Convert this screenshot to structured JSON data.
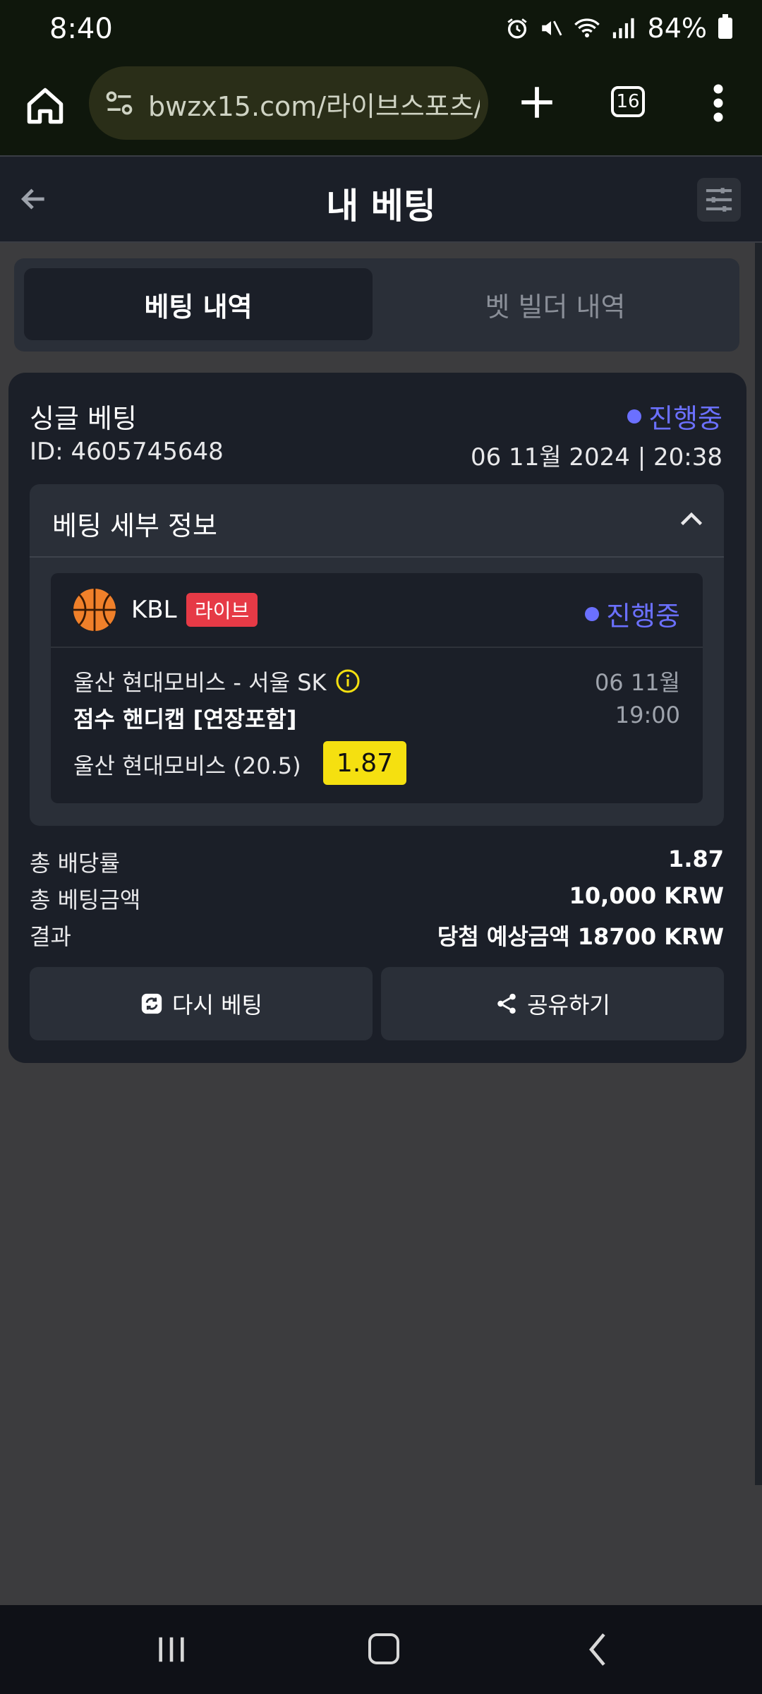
{
  "status_bar": {
    "time": "8:40",
    "battery_percent": "84%"
  },
  "browser": {
    "url": "bwzx15.com/라이브스포츠/ma",
    "tab_count": "16"
  },
  "header": {
    "title": "내 베팅"
  },
  "tabs": [
    {
      "label": "베팅 내역",
      "active": true
    },
    {
      "label": "벳 빌더 내역",
      "active": false
    }
  ],
  "bet": {
    "type": "싱글 베팅",
    "status": "진행중",
    "id": "ID: 4605745648",
    "datetime": "06 11월 2024 | 20:38",
    "details_title": "베팅 세부 정보",
    "event": {
      "league": "KBL",
      "live_label": "라이브",
      "status": "진행중",
      "match": "울산 현대모비스 - 서울 SK",
      "date": "06 11월",
      "time": "19:00",
      "market": "점수 핸디캡 [연장포함]",
      "selection": "울산 현대모비스 (20.5)",
      "odds": "1.87"
    },
    "summary": {
      "total_odds_label": "총 배당률",
      "total_odds": "1.87",
      "total_stake_label": "총 베팅금액",
      "total_stake": "10,000 KRW",
      "result_label": "결과",
      "result": "당첨 예상금액 18700 KRW"
    },
    "actions": {
      "rebet_label": "다시 베팅",
      "share_label": "공유하기"
    }
  },
  "colors": {
    "accent": "#6b70ff",
    "live_badge": "#e63a46",
    "odds_badge": "#f5e010",
    "card_bg": "#1b1f28",
    "panel_bg": "#2a2f38"
  }
}
